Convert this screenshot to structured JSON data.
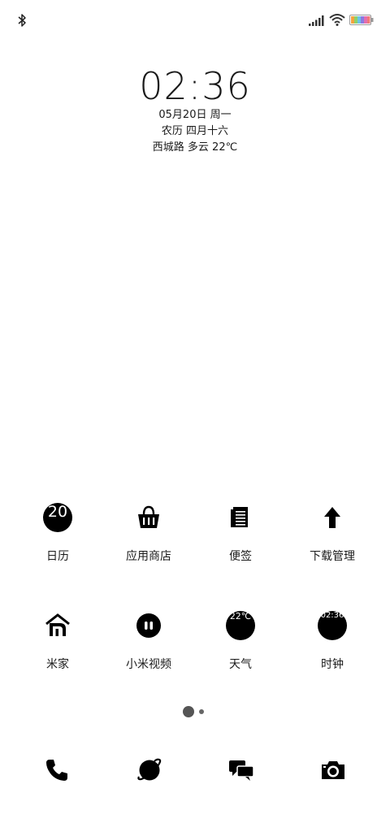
{
  "status_bar": {
    "icons": [
      "bluetooth-icon",
      "signal-icon",
      "wifi-icon",
      "battery-icon"
    ]
  },
  "clock_widget": {
    "time": "02:36",
    "date": "05月20日 周一",
    "lunar": "农历 四月十六",
    "weather": "西城路 多云 22℃"
  },
  "apps": [
    {
      "label": "日历",
      "icon": "calendar-icon",
      "badge": "20"
    },
    {
      "label": "应用商店",
      "icon": "shopping-basket-icon"
    },
    {
      "label": "便签",
      "icon": "notes-icon"
    },
    {
      "label": "下载管理",
      "icon": "download-arrow-icon"
    },
    {
      "label": "米家",
      "icon": "mi-home-icon"
    },
    {
      "label": "小米视频",
      "icon": "video-icon"
    },
    {
      "label": "天气",
      "icon": "weather-icon",
      "badge": "22℃"
    },
    {
      "label": "时钟",
      "icon": "clock-icon",
      "badge": "02:36"
    }
  ],
  "page_indicator": {
    "current": 1,
    "total": 2
  },
  "dock": [
    "phone-icon",
    "browser-icon",
    "messages-icon",
    "camera-icon"
  ]
}
